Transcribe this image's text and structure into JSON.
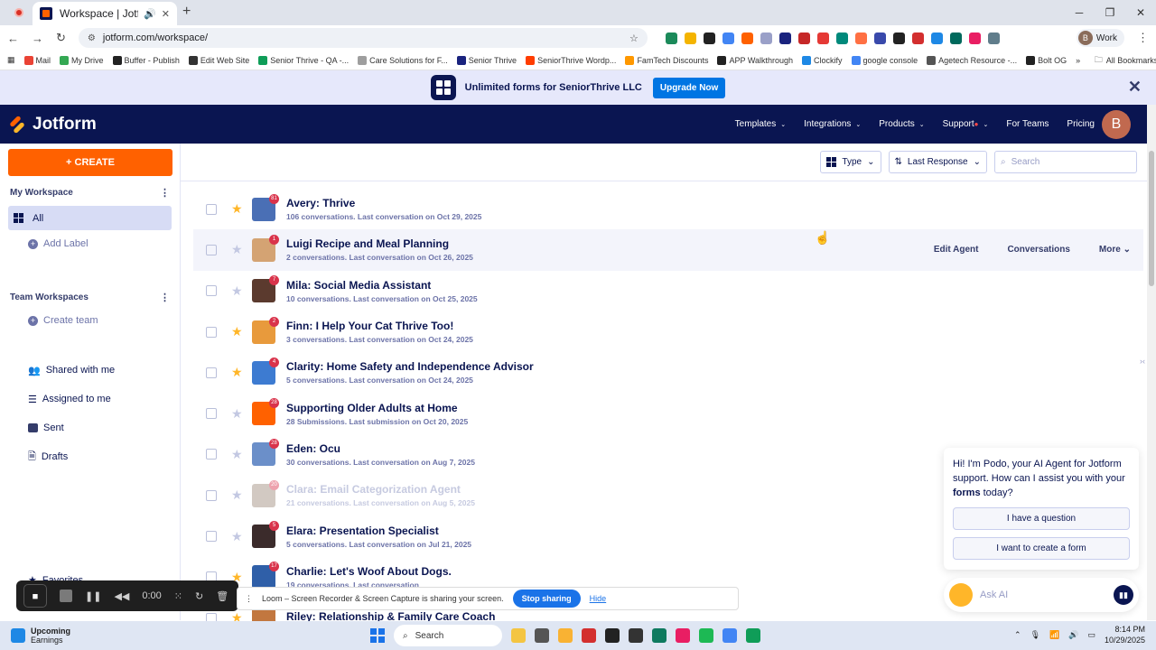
{
  "browser": {
    "tab_title": "Workspace | Jotform",
    "url": "jotform.com/workspace/",
    "profile_label": "Work",
    "profile_initial": "B",
    "bookmarks": [
      "Mail",
      "My Drive",
      "Buffer - Publish",
      "Edit Web Site",
      "Senior Thrive - QA -...",
      "Care Solutions for F...",
      "Senior Thrive",
      "SeniorThrive Wordp...",
      "FamTech Discounts",
      "APP Walkthrough",
      "Clockify",
      "google console",
      "Agetech Resource -...",
      "Bolt OG"
    ],
    "all_bookmarks": "All Bookmarks"
  },
  "promo": {
    "text": "Unlimited forms for SeniorThrive LLC",
    "upgrade_label": "Upgrade Now"
  },
  "header": {
    "brand": "Jotform",
    "nav": [
      "Templates",
      "Integrations",
      "Products",
      "Support",
      "For Teams",
      "Pricing"
    ],
    "avatar_initial": "B"
  },
  "sidebar": {
    "create_label": "+ CREATE",
    "my_workspace": "My Workspace",
    "all_label": "All",
    "add_label": "Add Label",
    "team_workspaces": "Team Workspaces",
    "create_team": "Create team",
    "items": [
      "Shared with me",
      "Assigned to me",
      "Sent",
      "Drafts"
    ],
    "favorites": "Favorites"
  },
  "toolbar": {
    "type_label": "Type",
    "sort_label": "Last Response",
    "search_placeholder": "Search"
  },
  "rows": [
    {
      "name": "Avery: Thrive",
      "meta": "106 conversations. Last conversation on Oct 29, 2025",
      "badge": "81",
      "starred": true,
      "color": "#4a6fb5"
    },
    {
      "name": "Luigi Recipe and Meal Planning",
      "meta": "2 conversations. Last conversation on Oct 26, 2025",
      "badge": "1",
      "starred": false,
      "color": "#d4a373"
    },
    {
      "name": "Mila: Social Media Assistant",
      "meta": "10 conversations. Last conversation on Oct 25, 2025",
      "badge": "7",
      "starred": false,
      "color": "#5b3a2e"
    },
    {
      "name": "Finn: I Help Your Cat Thrive Too!",
      "meta": "3 conversations. Last conversation on Oct 24, 2025",
      "badge": "2",
      "starred": true,
      "color": "#e89a3c"
    },
    {
      "name": "Clarity: Home Safety and Independence Advisor",
      "meta": "5 conversations. Last conversation on Oct 24, 2025",
      "badge": "4",
      "starred": true,
      "color": "#3d7bd1"
    },
    {
      "name": "Supporting Older Adults at Home",
      "meta": "28 Submissions. Last submission on Oct 20, 2025",
      "badge": "28",
      "starred": false,
      "color": "#ff6100"
    },
    {
      "name": "Eden: Ocu",
      "meta": "30 conversations. Last conversation on Aug 7, 2025",
      "badge": "28",
      "starred": false,
      "color": "#6b8fc9"
    },
    {
      "name": "Clara: Email Categorization Agent",
      "meta": "21 conversations. Last conversation on Aug 5, 2025",
      "badge": "20",
      "starred": false,
      "color": "#9c8a7a"
    },
    {
      "name": "Elara: Presentation Specialist",
      "meta": "5 conversations. Last conversation on Jul 21, 2025",
      "badge": "5",
      "starred": false,
      "color": "#3b2b2b"
    },
    {
      "name": "Charlie: Let's Woof About Dogs.",
      "meta": "19 conversations. Last conversation",
      "badge": "17",
      "starred": true,
      "color": "#2f5fa8"
    },
    {
      "name": "Riley: Relationship & Family Care Coach",
      "meta": "",
      "badge": "",
      "starred": true,
      "color": "#c2773f"
    }
  ],
  "row_actions": {
    "edit": "Edit Agent",
    "conversations": "Conversations",
    "more": "More"
  },
  "podo": {
    "msg_pre": "Hi! I'm Podo, your AI Agent for Jotform support. How can I assist you with your ",
    "msg_bold": "forms",
    "msg_post": " today?",
    "q1": "I have a question",
    "q2": "I want to create a form",
    "ask_placeholder": "Ask AI"
  },
  "loom": {
    "timer": "0:00",
    "share_text": "Loom – Screen Recorder & Screen Capture is sharing your screen.",
    "stop_label": "Stop sharing",
    "hide_label": "Hide"
  },
  "taskbar": {
    "weather_title": "Upcoming",
    "weather_sub": "Earnings",
    "search_label": "Search",
    "time": "8:14 PM",
    "date": "10/29/2025"
  }
}
